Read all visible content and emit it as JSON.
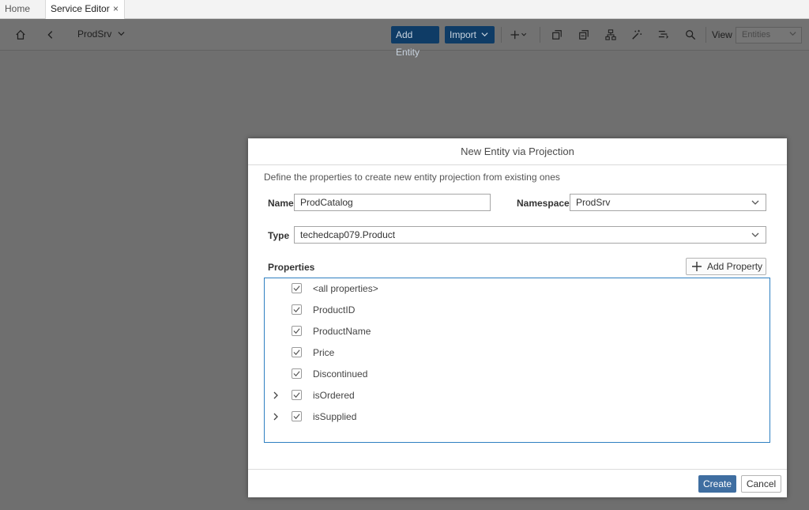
{
  "tabs": [
    {
      "label": "Home"
    },
    {
      "label": "Service Editor",
      "close": "×"
    }
  ],
  "toolbar": {
    "breadcrumb": "ProdSrv",
    "add_entity": "Add Entity",
    "import": "Import",
    "view_label": "View",
    "view_value": "Entities"
  },
  "dialog": {
    "title": "New Entity via Projection",
    "description": "Define the properties to create new entity projection from existing ones",
    "name_label": "Name",
    "name_value": "ProdCatalog",
    "namespace_label": "Namespace",
    "namespace_value": "ProdSrv",
    "type_label": "Type",
    "type_value": "techedcap079.Product",
    "properties_label": "Properties",
    "add_property": "Add Property",
    "properties": [
      {
        "label": "<all properties>",
        "checked": true,
        "expandable": false
      },
      {
        "label": "ProductID",
        "checked": true,
        "expandable": false
      },
      {
        "label": "ProductName",
        "checked": true,
        "expandable": false
      },
      {
        "label": "Price",
        "checked": true,
        "expandable": false
      },
      {
        "label": "Discontinued",
        "checked": true,
        "expandable": false
      },
      {
        "label": "isOrdered",
        "checked": true,
        "expandable": true
      },
      {
        "label": "isSupplied",
        "checked": true,
        "expandable": true
      }
    ],
    "create": "Create",
    "cancel": "Cancel"
  }
}
